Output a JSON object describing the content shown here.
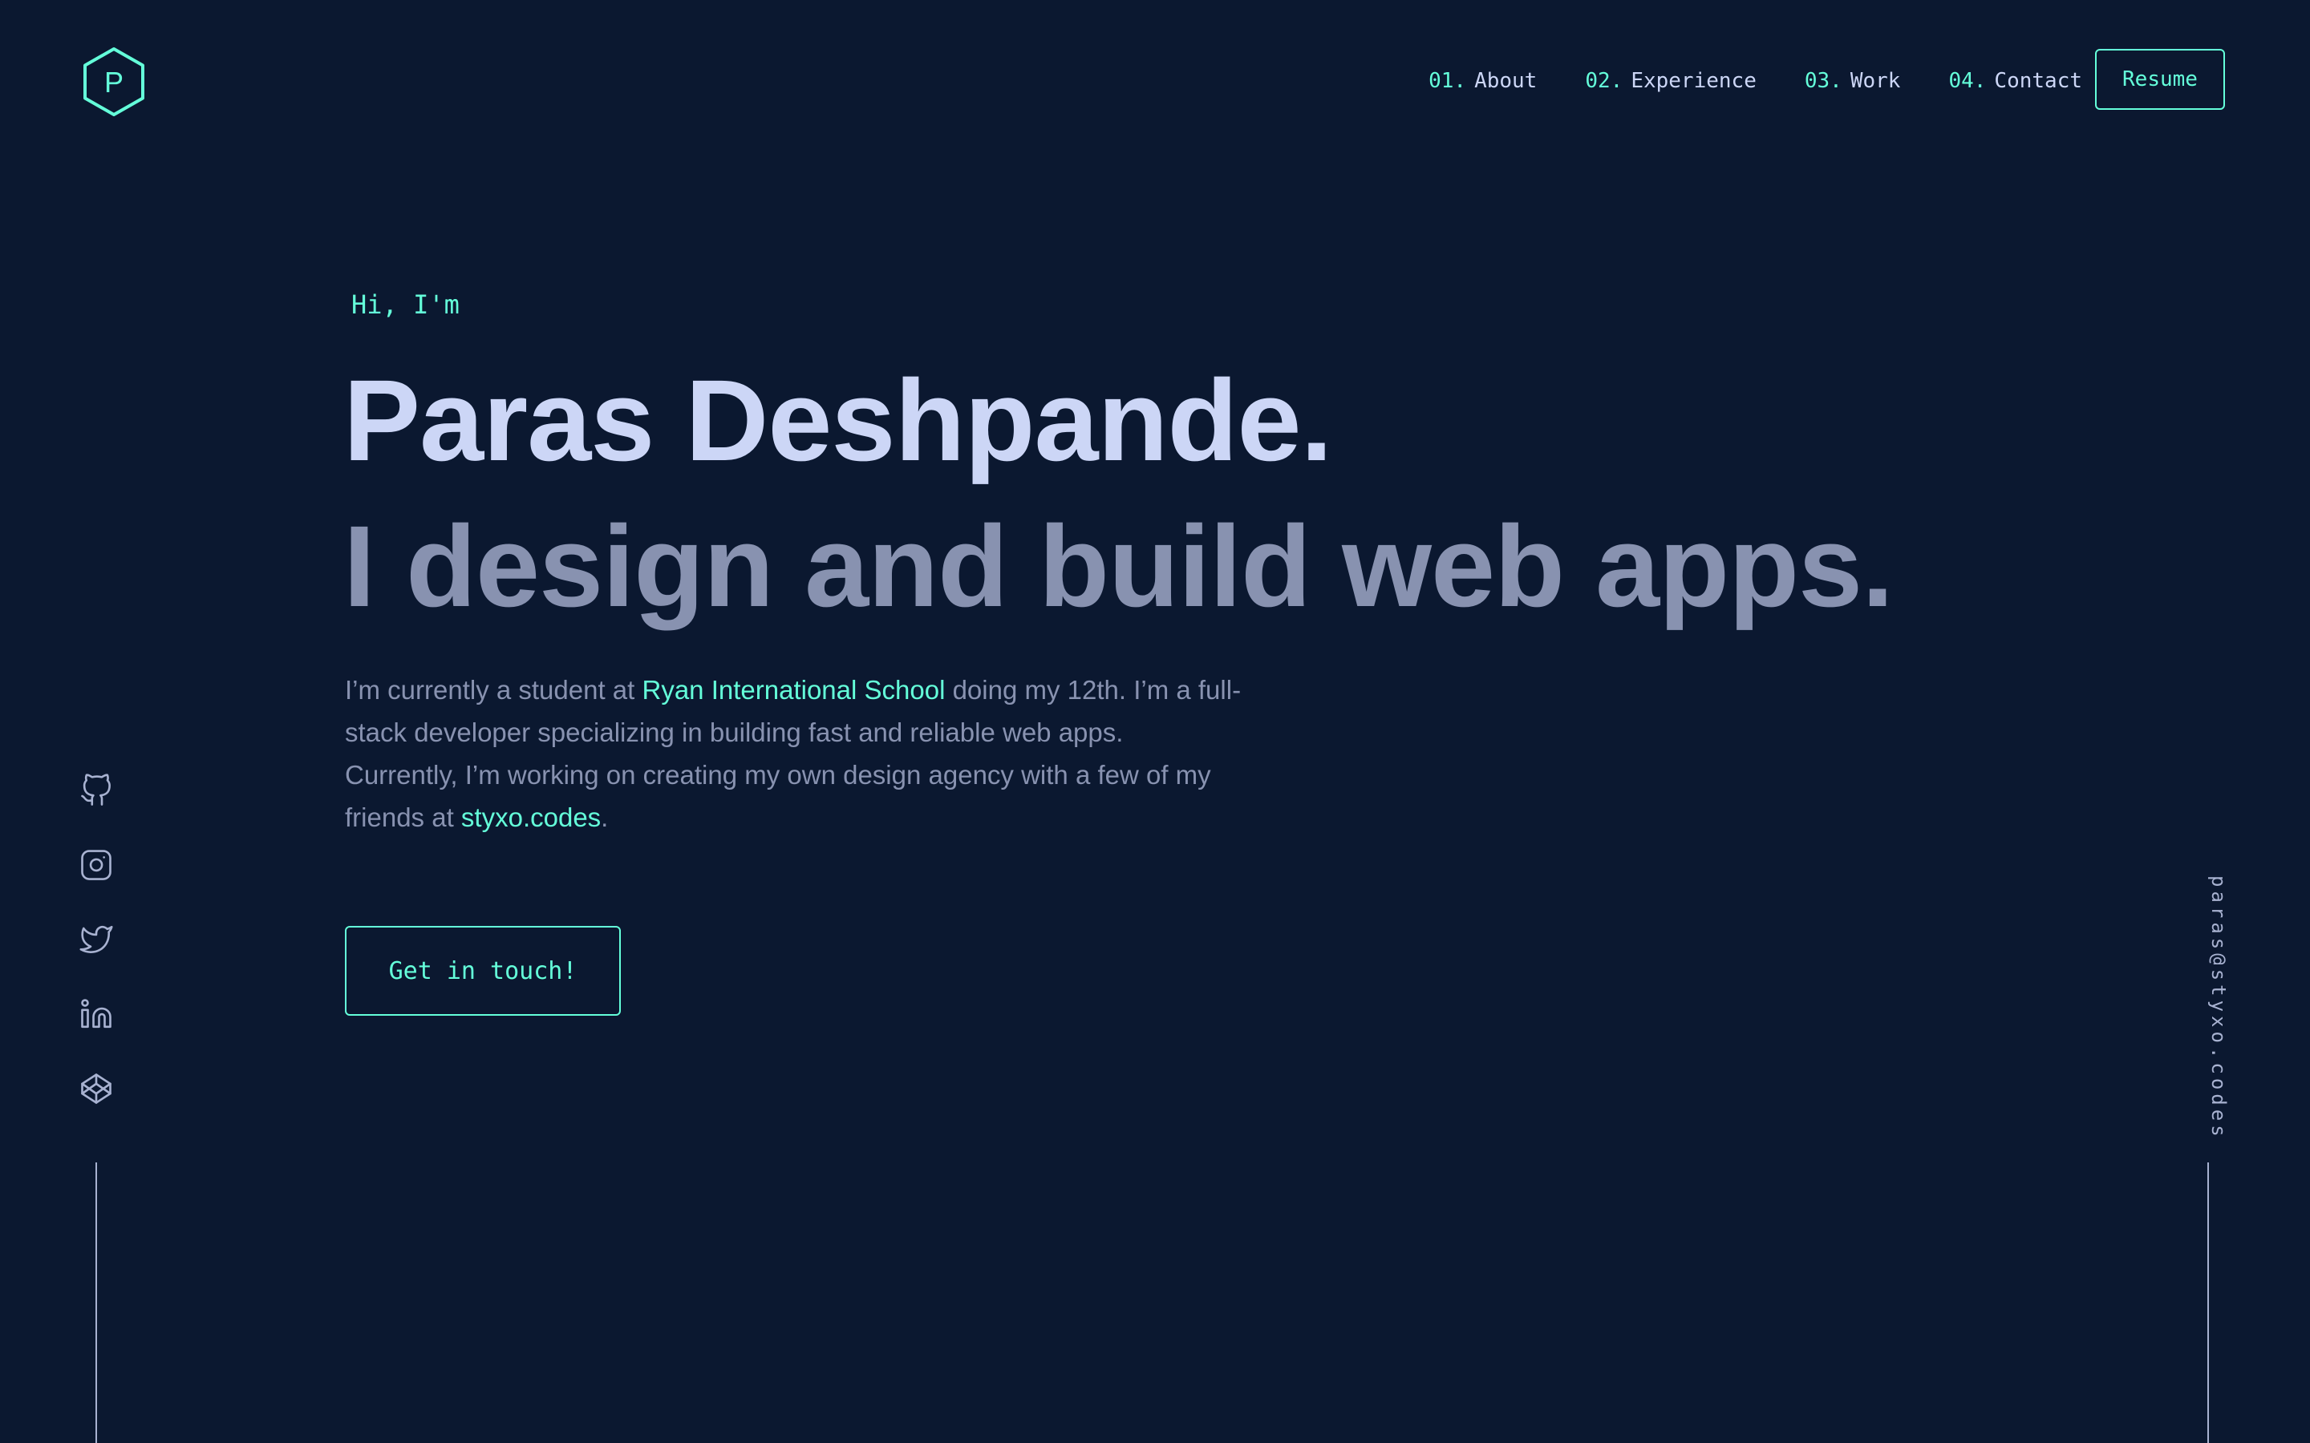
{
  "logo": {
    "letter": "P",
    "icon": "hexagon-logo-icon"
  },
  "nav": {
    "items": [
      {
        "num": "01.",
        "label": "About"
      },
      {
        "num": "02.",
        "label": "Experience"
      },
      {
        "num": "03.",
        "label": "Work"
      },
      {
        "num": "04.",
        "label": "Contact"
      }
    ],
    "resume_label": "Resume"
  },
  "hero": {
    "greeting": "Hi, I'm",
    "name": "Paras Deshpande.",
    "tagline": "I design and build web apps.",
    "bio": {
      "part1": "I’m currently a student at ",
      "school_link": "Ryan International School",
      "part2": " doing my 12th. I’m a full-stack developer specializing in building fast and reliable web apps. Currently, I’m working on creating my own design agency with a few of my friends at ",
      "agency_link": "styxo.codes",
      "part3": "."
    },
    "cta_label": "Get in touch!"
  },
  "social": {
    "icons": [
      "github-icon",
      "instagram-icon",
      "twitter-icon",
      "linkedin-icon",
      "codepen-icon"
    ]
  },
  "email": "paras@styxo.codes",
  "colors": {
    "background": "#0b1830",
    "accent": "#64ffda",
    "heading": "#ccd6f6",
    "body": "#8892b0",
    "light": "#a8b2d1"
  }
}
